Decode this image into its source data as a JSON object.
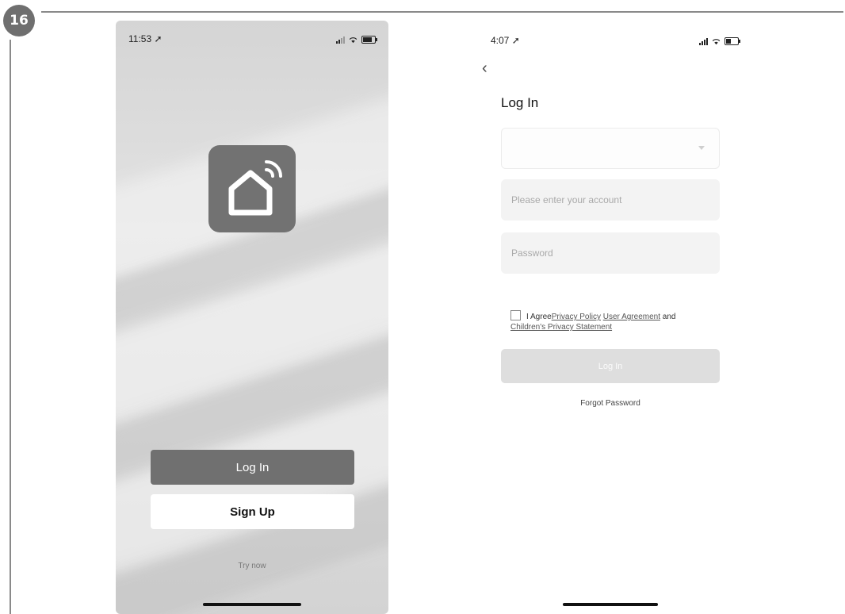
{
  "step": {
    "number": "16"
  },
  "screen_welcome": {
    "status_time": "11:53",
    "logo_icon": "smart-home-wifi-icon",
    "login_label": "Log In",
    "signup_label": "Sign Up",
    "try_now_label": "Try now"
  },
  "screen_login": {
    "status_time": "4:07",
    "back_icon": "chevron-left-icon",
    "title": "Log In",
    "account_placeholder": "Please enter your account",
    "password_placeholder": "Password",
    "agree_text": "I Agree",
    "privacy_policy": "Privacy Policy",
    "user_agreement": "User Agreement",
    "and_text": "and",
    "childrens_privacy": "Children's Privacy Statement",
    "login_button": "Log In",
    "forgot_password": "Forgot Password"
  }
}
